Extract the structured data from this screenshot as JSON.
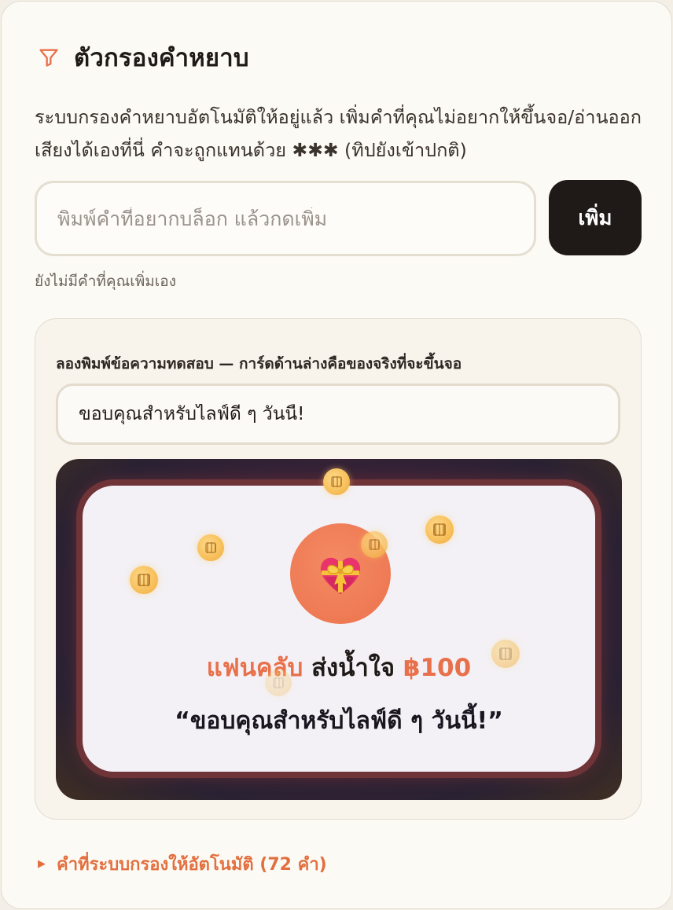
{
  "header": {
    "title": "ตัวกรองคำหยาบ",
    "icon": "filter-icon",
    "icon_color": "#e8704a"
  },
  "description": "ระบบกรองคำหยาบอัตโนมัติให้อยู่แล้ว เพิ่มคำที่คุณไม่อยากให้ขึ้นจอ/อ่านออกเสียงได้เองที่นี่ คำจะถูกแทนด้วย ✱✱✱ (ทิปยังเข้าปกติ)",
  "word_input": {
    "value": "",
    "placeholder": "พิมพ์คำที่อยากบล็อก แล้วกดเพิ่ม"
  },
  "add_button": {
    "label": "เพิ่ม"
  },
  "empty_note": "ยังไม่มีคำที่คุณเพิ่มเอง",
  "preview": {
    "label": "ลองพิมพ์ข้อความทดสอบ — การ์ดด้านล่างคือของจริงที่จะขึ้นจอ",
    "test_input_value": "ขอบคุณสำหรับไลฟ์ดี ๆ วันนี้!",
    "card": {
      "gift_icon": "gift-heart-icon",
      "sender": "แฟนคลับ",
      "action": "ส่งน้ำใจ",
      "amount": "฿100",
      "message": "“ขอบคุณสำหรับไลฟ์ดี ๆ วันนี้!”"
    }
  },
  "auto_filter_toggle": {
    "label": "คำที่ระบบกรองให้อัตโนมัติ (72 คำ)",
    "icon": "triangle-right-icon"
  },
  "colors": {
    "accent": "#e8704a",
    "button_bg": "#1f1917",
    "panel_bg": "#fcfaf5"
  }
}
